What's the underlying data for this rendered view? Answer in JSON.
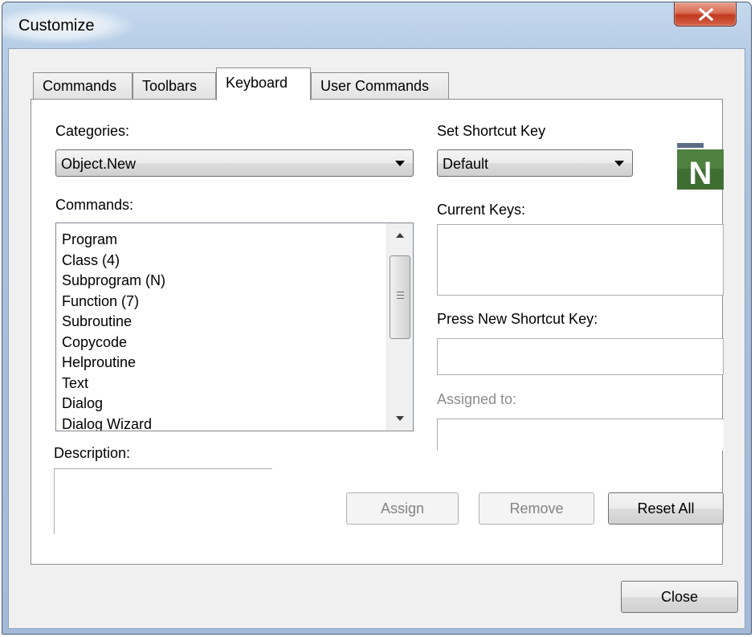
{
  "window": {
    "title": "Customize"
  },
  "tabs": [
    {
      "label": "Commands"
    },
    {
      "label": "Toolbars"
    },
    {
      "label": "Keyboard",
      "active": true
    },
    {
      "label": "User Commands"
    }
  ],
  "keyboard": {
    "categories_label": "Categories:",
    "categories_value": "Object.New",
    "commands_label": "Commands:",
    "commands": [
      "Program",
      "Class (4)",
      "Subprogram (N)",
      "Function (7)",
      "Subroutine",
      "Copycode",
      "Helproutine",
      "Text",
      "Dialog",
      "Dialog Wizard"
    ],
    "description_label": "Description:",
    "description_value": "",
    "set_shortcut_label": "Set Shortcut Key",
    "set_shortcut_value": "Default",
    "current_keys_label": "Current Keys:",
    "press_new_label": "Press New Shortcut Key:",
    "press_new_value": "",
    "assigned_to_label": "Assigned to:",
    "assigned_to_value": "",
    "assign_button": "Assign",
    "remove_button": "Remove",
    "reset_all_button": "Reset All",
    "logo_letter": "N"
  },
  "footer": {
    "close_button": "Close"
  },
  "colors": {
    "logo_green": "#3f6e33",
    "logo_bar_blue": "#5b6e86",
    "titlebar_close": "#c2391d",
    "frame_blue": "#b6cde6"
  }
}
